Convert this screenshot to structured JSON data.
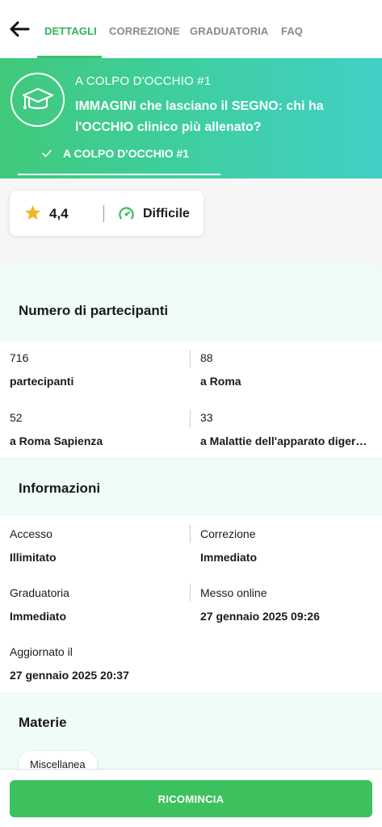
{
  "nav": {
    "tabs": [
      {
        "label": "DETTAGLI",
        "active": true
      },
      {
        "label": "CORREZIONE",
        "active": false
      },
      {
        "label": "GRADUATORIA",
        "active": false
      },
      {
        "label": "FAQ",
        "active": false
      }
    ]
  },
  "header": {
    "kicker": "A COLPO D'OCCHIO #1",
    "title": "IMMAGINI che lasciano il SEGNO: chi ha l'OCCHIO clinico più allenato?",
    "subtab_label": "A COLPO D'OCCHIO #1"
  },
  "rating": {
    "value": "4,4",
    "difficulty": "Difficile"
  },
  "participants": {
    "title": "Numero di partecipanti",
    "items": [
      {
        "count": "716",
        "label": "partecipanti"
      },
      {
        "count": "88",
        "label": "a Roma"
      },
      {
        "count": "52",
        "label": "a Roma Sapienza"
      },
      {
        "count": "33",
        "label": "a Malattie dell'apparato digerente"
      }
    ]
  },
  "info": {
    "title": "Informazioni",
    "items": [
      {
        "key": "Accesso",
        "value": "Illimitato"
      },
      {
        "key": "Correzione",
        "value": "Immediato"
      },
      {
        "key": "Graduatoria",
        "value": "Immediato"
      },
      {
        "key": "Messo online",
        "value": "27 gennaio 2025 09:26"
      },
      {
        "key": "Aggiornato il",
        "value": "27 gennaio 2025 20:37"
      }
    ]
  },
  "subjects": {
    "title": "Materie",
    "chips": [
      "Miscellanea"
    ]
  },
  "footer": {
    "cta_label": "RICOMINCIA"
  },
  "colors": {
    "accent": "#3dc15f",
    "header_gradient_start": "#40c97a",
    "header_gradient_end": "#42cfc6",
    "section_bg": "#effcf8",
    "star": "#f1b62a"
  }
}
